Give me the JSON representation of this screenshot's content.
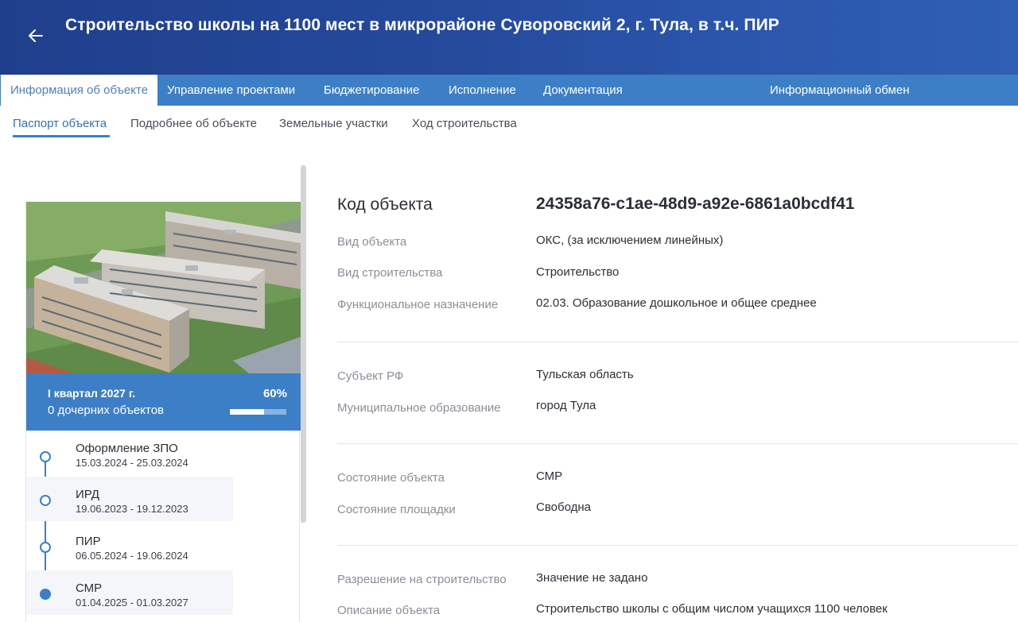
{
  "header": {
    "title": "Строительство школы на 1100 мест в микрорайоне Суворовский 2, г. Тула, в т.ч. ПИР",
    "back_icon": "arrow-left-icon"
  },
  "tabs": [
    {
      "label": "Информация об объекте",
      "active": true
    },
    {
      "label": "Управление проектами"
    },
    {
      "label": "Бюджетирование"
    },
    {
      "label": "Исполнение"
    },
    {
      "label": "Документация"
    },
    {
      "label": "Информационный обмен"
    }
  ],
  "subtabs": [
    {
      "label": "Паспорт объекта",
      "active": true
    },
    {
      "label": "Подробнее об объекте"
    },
    {
      "label": "Земельные участки"
    },
    {
      "label": "Ход строительства"
    }
  ],
  "card": {
    "period": "I квартал 2027 г.",
    "children": "0 дочерних объектов",
    "progress_label": "60%",
    "progress": 0.6,
    "timeline": [
      {
        "title": "Оформление ЗПО",
        "dates": "15.03.2024 - 25.03.2024"
      },
      {
        "title": "ИРД",
        "dates": "19.06.2023 - 19.12.2023"
      },
      {
        "title": "ПИР",
        "dates": "06.05.2024 - 19.06.2024"
      },
      {
        "title": "СМР",
        "dates": "01.04.2025 - 01.03.2027"
      }
    ]
  },
  "details": {
    "code_label": "Код объекта",
    "code_value": "24358a76-c1ae-48d9-a92e-6861a0bcdf41",
    "rows": [
      {
        "label": "Вид объекта",
        "value": "ОКС, (за исключением линейных)"
      },
      {
        "label": "Вид строительства",
        "value": "Строительство"
      },
      {
        "label": "Функциональное назначение",
        "value": "02.03. Образование дошкольное и общее среднее"
      },
      {
        "label": "Субъект РФ",
        "value": "Тульская область"
      },
      {
        "label": "Муниципальное образование",
        "value": "город Тула"
      },
      {
        "label": "Состояние объекта",
        "value": "СМР"
      },
      {
        "label": "Состояние площадки",
        "value": "Свободна"
      },
      {
        "label": "Разрешение на строительство",
        "value": "Значение не задано"
      },
      {
        "label": "Описание объекта",
        "value": "Строительство школы с общим числом учащихся 1100 человек"
      }
    ]
  },
  "colors": {
    "header": "#254a9c",
    "accent": "#3d7fc6"
  }
}
